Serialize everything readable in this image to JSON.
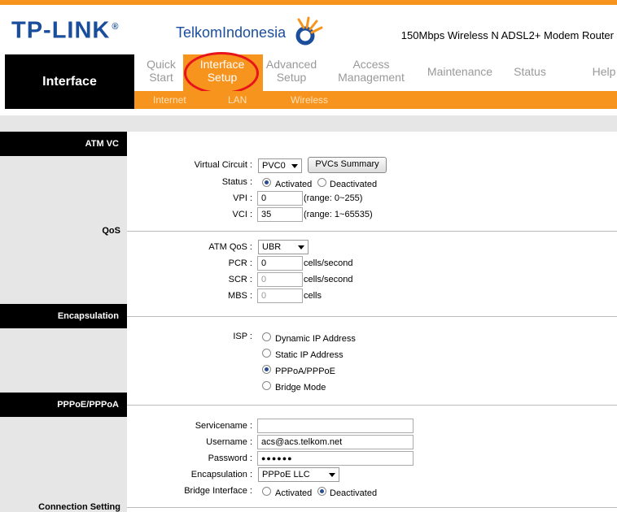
{
  "header": {
    "brand": "TP-LINK",
    "brand_mark": "®",
    "partner": "TelkomIndonesia",
    "product": "150Mbps Wireless N ADSL2+ Modem Router",
    "accent": "#f7941d"
  },
  "nav": {
    "section_title": "Interface",
    "items": [
      {
        "line1": "Quick",
        "line2": "Start"
      },
      {
        "line1": "Interface",
        "line2": "Setup"
      },
      {
        "line1": "Advanced",
        "line2": "Setup"
      },
      {
        "line1": "Access",
        "line2": "Management"
      },
      {
        "line1": "Maintenance",
        "line2": ""
      },
      {
        "line1": "Status",
        "line2": ""
      },
      {
        "line1": "Help",
        "line2": ""
      }
    ],
    "subitems": [
      "Internet",
      "LAN",
      "Wireless"
    ]
  },
  "sections": {
    "atm_vc": "ATM VC",
    "qos": "QoS",
    "encapsulation": "Encapsulation",
    "pppoe": "PPPoE/PPPoA",
    "connection": "Connection Setting"
  },
  "atm": {
    "vc_label": "Virtual Circuit :",
    "vc_value": "PVC0",
    "pvc_summary": "PVCs Summary",
    "status_label": "Status :",
    "activated": "Activated",
    "deactivated": "Deactivated",
    "vpi_label": "VPI :",
    "vpi_value": "0",
    "vpi_range": "(range: 0~255)",
    "vci_label": "VCI :",
    "vci_value": "35",
    "vci_range": "(range: 1~65535)"
  },
  "qos": {
    "atm_qos_label": "ATM QoS :",
    "atm_qos_value": "UBR",
    "pcr_label": "PCR :",
    "pcr_value": "0",
    "scr_label": "SCR :",
    "scr_value": "0",
    "mbs_label": "MBS :",
    "mbs_value": "0",
    "cells_per_second": "cells/second",
    "cells": "cells"
  },
  "encap": {
    "isp_label": "ISP :",
    "options": [
      "Dynamic IP Address",
      "Static IP Address",
      "PPPoA/PPPoE",
      "Bridge Mode"
    ]
  },
  "pppoe": {
    "servicename_label": "Servicename :",
    "servicename_value": "",
    "username_label": "Username :",
    "username_value": "acs@acs.telkom.net",
    "password_label": "Password :",
    "password_value": "●●●●●●",
    "encap_label": "Encapsulation :",
    "encap_value": "PPPoE LLC",
    "bridge_label": "Bridge Interface :",
    "activated": "Activated",
    "deactivated": "Deactivated"
  }
}
